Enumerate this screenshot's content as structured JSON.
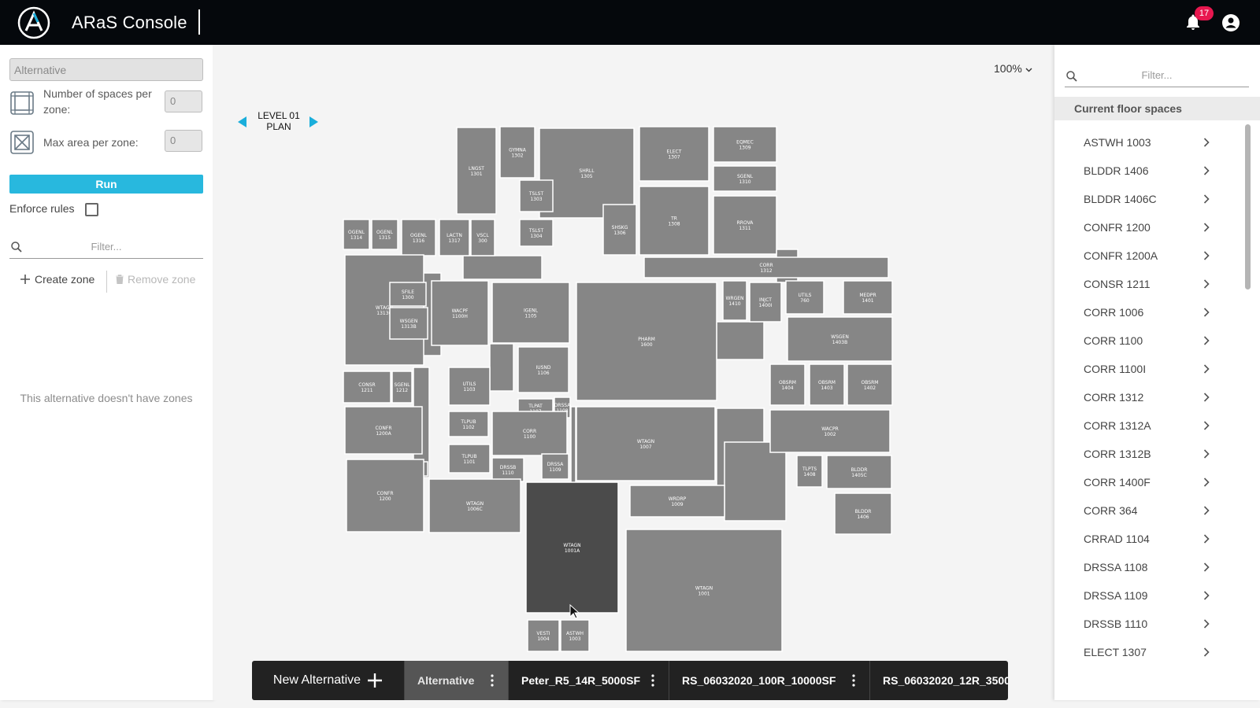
{
  "app": {
    "title": "ARaS Console",
    "notification_count": "17",
    "icons": [
      "aras-logo-icon",
      "bell-icon",
      "account-circle-icon"
    ]
  },
  "left_panel": {
    "alternative_value": "Alternative",
    "spaces_per_zone_label": "Number of spaces per zone:",
    "spaces_per_zone_value": "0",
    "max_area_label": "Max area per zone:",
    "max_area_value": "0",
    "run_label": "Run",
    "enforce_rules_label": "Enforce rules",
    "enforce_rules_checked": false,
    "filter_placeholder": "Filter...",
    "create_zone_label": "Create zone",
    "remove_zone_label": "Remove zone",
    "empty_message": "This alternative doesn't have zones"
  },
  "center": {
    "zoom_label": "100%",
    "level_line1": "LEVEL 01",
    "level_line2": "PLAN",
    "rooms": [
      {
        "code": "LNGST",
        "num": "1301"
      },
      {
        "code": "GYMNA",
        "num": "1302"
      },
      {
        "code": "SHRLL",
        "num": "1305"
      },
      {
        "code": "ELECT",
        "num": "1307"
      },
      {
        "code": "EQMEC",
        "num": "1309"
      },
      {
        "code": "SGENL",
        "num": "1310"
      },
      {
        "code": "TSLST",
        "num": "1303"
      },
      {
        "code": "TSLST",
        "num": "1304"
      },
      {
        "code": "SHSKG",
        "num": "1306"
      },
      {
        "code": "TR",
        "num": "1308"
      },
      {
        "code": "RROVA",
        "num": "1311"
      },
      {
        "code": "OGENL",
        "num": "1314"
      },
      {
        "code": "OGENL",
        "num": "1315"
      },
      {
        "code": "OGENL",
        "num": "1316"
      },
      {
        "code": "LACTN",
        "num": "1317"
      },
      {
        "code": "VSCL",
        "num": "300"
      },
      {
        "code": "CORR",
        "num": "1312"
      },
      {
        "code": "WTAGN",
        "num": "1313C"
      },
      {
        "code": "SFILE",
        "num": "1300"
      },
      {
        "code": "WSGEN",
        "num": "1313B"
      },
      {
        "code": "WACPF",
        "num": "1100H"
      },
      {
        "code": "IGENL",
        "num": "1105"
      },
      {
        "code": "PHARM",
        "num": "1600"
      },
      {
        "code": "WRGEN",
        "num": "1410"
      },
      {
        "code": "INJCT",
        "num": "1400I"
      },
      {
        "code": "UTILS",
        "num": "760"
      },
      {
        "code": "MEDPR",
        "num": "1401"
      },
      {
        "code": "WSGEN",
        "num": "1403B"
      },
      {
        "code": "CONSR",
        "num": "1211"
      },
      {
        "code": "SGENL",
        "num": "1212"
      },
      {
        "code": "UTILS",
        "num": "1103"
      },
      {
        "code": "IUSND",
        "num": "1106"
      },
      {
        "code": "TLPAT",
        "num": "1107"
      },
      {
        "code": "DRSSA",
        "num": "1108"
      },
      {
        "code": "OBSRM",
        "num": "1404"
      },
      {
        "code": "OBSRM",
        "num": "1403"
      },
      {
        "code": "OBSRM",
        "num": "1402"
      },
      {
        "code": "CONFR",
        "num": "1200A"
      },
      {
        "code": "TLPUB",
        "num": "1102"
      },
      {
        "code": "CORR",
        "num": "1100"
      },
      {
        "code": "WTAGN",
        "num": "1007"
      },
      {
        "code": "WACPR",
        "num": "1002"
      },
      {
        "code": "TLPUB",
        "num": "1101"
      },
      {
        "code": "DRSSB",
        "num": "1110"
      },
      {
        "code": "DRSSA",
        "num": "1109"
      },
      {
        "code": "TLPTS",
        "num": "1408"
      },
      {
        "code": "BLDDR",
        "num": "1405C"
      },
      {
        "code": "CONFR",
        "num": "1200"
      },
      {
        "code": "WTAGN",
        "num": "1006C"
      },
      {
        "code": "WRDRP",
        "num": "1009"
      },
      {
        "code": "BLDDR",
        "num": "1406"
      },
      {
        "code": "WTAGN",
        "num": "1001A"
      },
      {
        "code": "WTAGN",
        "num": "1001"
      },
      {
        "code": "VESTI",
        "num": "1004"
      },
      {
        "code": "ASTWH",
        "num": "1003"
      }
    ]
  },
  "alternatives_bar": {
    "new_label": "New Alternative",
    "tabs": [
      {
        "label": "Alternative",
        "active": true
      },
      {
        "label": "Peter_R5_14R_5000SF",
        "active": false
      },
      {
        "label": "RS_06032020_100R_10000SF",
        "active": false
      },
      {
        "label": "RS_06032020_12R_3500",
        "active": false
      }
    ]
  },
  "right_panel": {
    "filter_placeholder": "Filter...",
    "section_title": "Current floor spaces",
    "spaces": [
      "ASTWH 1003",
      "BLDDR 1406",
      "BLDDR 1406C",
      "CONFR 1200",
      "CONFR 1200A",
      "CONSR 1211",
      "CORR 1006",
      "CORR 1100",
      "CORR 1100I",
      "CORR 1312",
      "CORR 1312A",
      "CORR 1312B",
      "CORR 1400F",
      "CORR 364",
      "CRRAD 1104",
      "DRSSA 1108",
      "DRSSA 1109",
      "DRSSB 1110",
      "ELECT 1307"
    ]
  },
  "colors": {
    "topbar": "#05080c",
    "accent": "#28b8de",
    "badge": "#e8174f",
    "room": "#868686",
    "room_selected": "#4b4b4b"
  }
}
